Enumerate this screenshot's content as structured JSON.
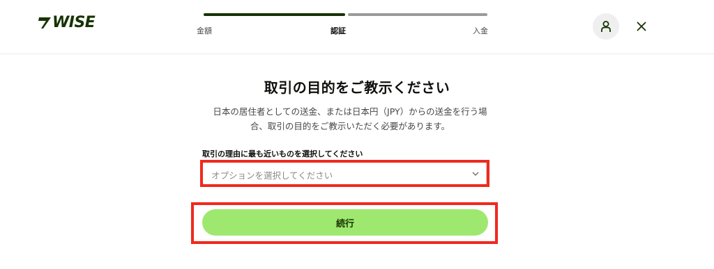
{
  "header": {
    "brand": "WISE",
    "steps": [
      "金額",
      "認証",
      "入金"
    ],
    "current_step": 2,
    "progress_fraction": 0.5
  },
  "main": {
    "title": "取引の目的をご教示ください",
    "description_line1": "日本の居住者としての送金、または日本円（JPY）からの送金を行う場",
    "description_line2": "合、取引の目的をご教示いただく必要があります。",
    "field_label": "取引の理由に最も近いものを選択してください",
    "select_placeholder": "オプションを選択してください",
    "continue_label": "続行"
  },
  "icons": {
    "logo": "wise-flag-logo-icon",
    "avatar": "user-icon",
    "close": "close-icon",
    "chevron": "chevron-down-icon"
  },
  "colors": {
    "brand_green": "#163300",
    "button_green": "#9fe870",
    "highlight_red": "#f0291d"
  }
}
